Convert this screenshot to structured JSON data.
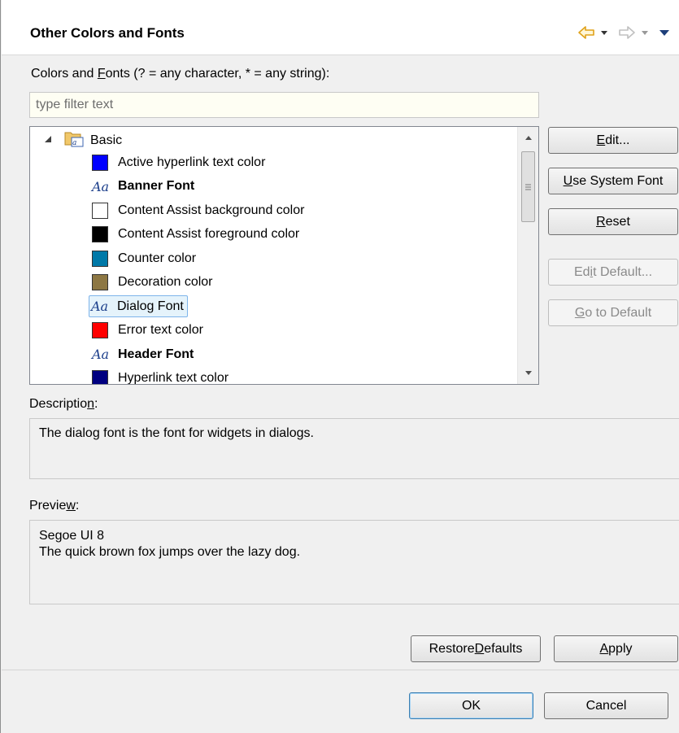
{
  "header": {
    "title": "Other Colors and Fonts",
    "back_icon": "back-arrow-icon",
    "forward_icon": "forward-arrow-icon",
    "accent_color": "#f5a623"
  },
  "filter": {
    "label_prefix": "Colors and ",
    "label_mnemonic": "F",
    "label_suffix": "onts (? = any character, * = any string):",
    "placeholder": "type filter text",
    "value": ""
  },
  "tree": {
    "root": {
      "label": "Basic",
      "icon": "folder-font-icon",
      "expanded": true
    },
    "items": [
      {
        "label": "Active hyperlink text color",
        "kind": "color",
        "color": "#0000ff",
        "bold": false
      },
      {
        "label": "Banner Font",
        "kind": "font",
        "bold": true
      },
      {
        "label": "Content Assist background color",
        "kind": "color",
        "color": "#ffffff",
        "bold": false
      },
      {
        "label": "Content Assist foreground color",
        "kind": "color",
        "color": "#000000",
        "bold": false
      },
      {
        "label": "Counter color",
        "kind": "color",
        "color": "#0079a8",
        "bold": false
      },
      {
        "label": "Decoration color",
        "kind": "color",
        "color": "#8d7743",
        "bold": false
      },
      {
        "label": "Dialog Font",
        "kind": "font",
        "bold": false,
        "selected": true
      },
      {
        "label": "Error text color",
        "kind": "color",
        "color": "#ff0000",
        "bold": false
      },
      {
        "label": "Header Font",
        "kind": "font",
        "bold": true
      },
      {
        "label": "Hyperlink text color",
        "kind": "color",
        "color": "#000080",
        "bold": false
      }
    ],
    "font_glyph": "Aa"
  },
  "buttons": {
    "edit": {
      "pre": "",
      "mn": "E",
      "post": "dit..."
    },
    "use_system_font": {
      "pre": "",
      "mn": "U",
      "post": "se System Font"
    },
    "reset": {
      "pre": "",
      "mn": "R",
      "post": "eset"
    },
    "edit_default": {
      "pre": "Ed",
      "mn": "i",
      "post": "t Default..."
    },
    "go_to_default": {
      "pre": "",
      "mn": "G",
      "post": "o to Default"
    },
    "restore_defaults": {
      "pre": "Restore ",
      "mn": "D",
      "post": "efaults"
    },
    "apply": {
      "pre": "",
      "mn": "A",
      "post": "pply"
    },
    "ok": "OK",
    "cancel": "Cancel"
  },
  "description": {
    "label_pre": "Descriptio",
    "label_mn": "n",
    "label_post": ":",
    "text": "The dialog font is the font for widgets in dialogs."
  },
  "preview": {
    "label_pre": "Previe",
    "label_mn": "w",
    "label_post": ":",
    "line1": "Segoe UI 8",
    "line2": "The quick brown fox jumps over the lazy dog."
  }
}
